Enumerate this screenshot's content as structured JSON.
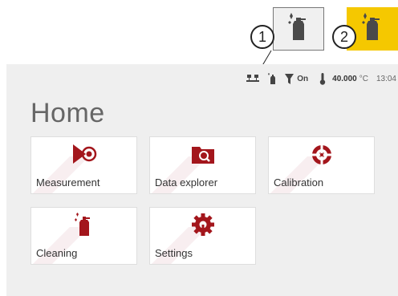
{
  "callouts": [
    {
      "number": "1",
      "icon": "cleaning-spray-icon",
      "highlight": "#f0f0f0"
    },
    {
      "number": "2",
      "icon": "cleaning-spray-icon",
      "highlight": "#f5c800"
    }
  ],
  "status_bar": {
    "network_icon": "network-icon",
    "cleaning_icon": "cleaning-spray-icon",
    "filter_icon": "funnel-icon",
    "filter_state": "On",
    "thermometer_icon": "thermometer-icon",
    "temperature": "40.000",
    "temperature_unit": "°C",
    "time": "13:04"
  },
  "page": {
    "title": "Home"
  },
  "tiles": [
    {
      "label": "Measurement",
      "icon": "measurement-icon"
    },
    {
      "label": "Data explorer",
      "icon": "folder-search-icon"
    },
    {
      "label": "Calibration",
      "icon": "crosshair-icon"
    },
    {
      "label": "Cleaning",
      "icon": "cleaning-spray-icon"
    },
    {
      "label": "Settings",
      "icon": "gear-icon"
    }
  ],
  "colors": {
    "accent": "#a3161c",
    "icon_dark": "#555555",
    "highlight_yellow": "#f5c800"
  }
}
